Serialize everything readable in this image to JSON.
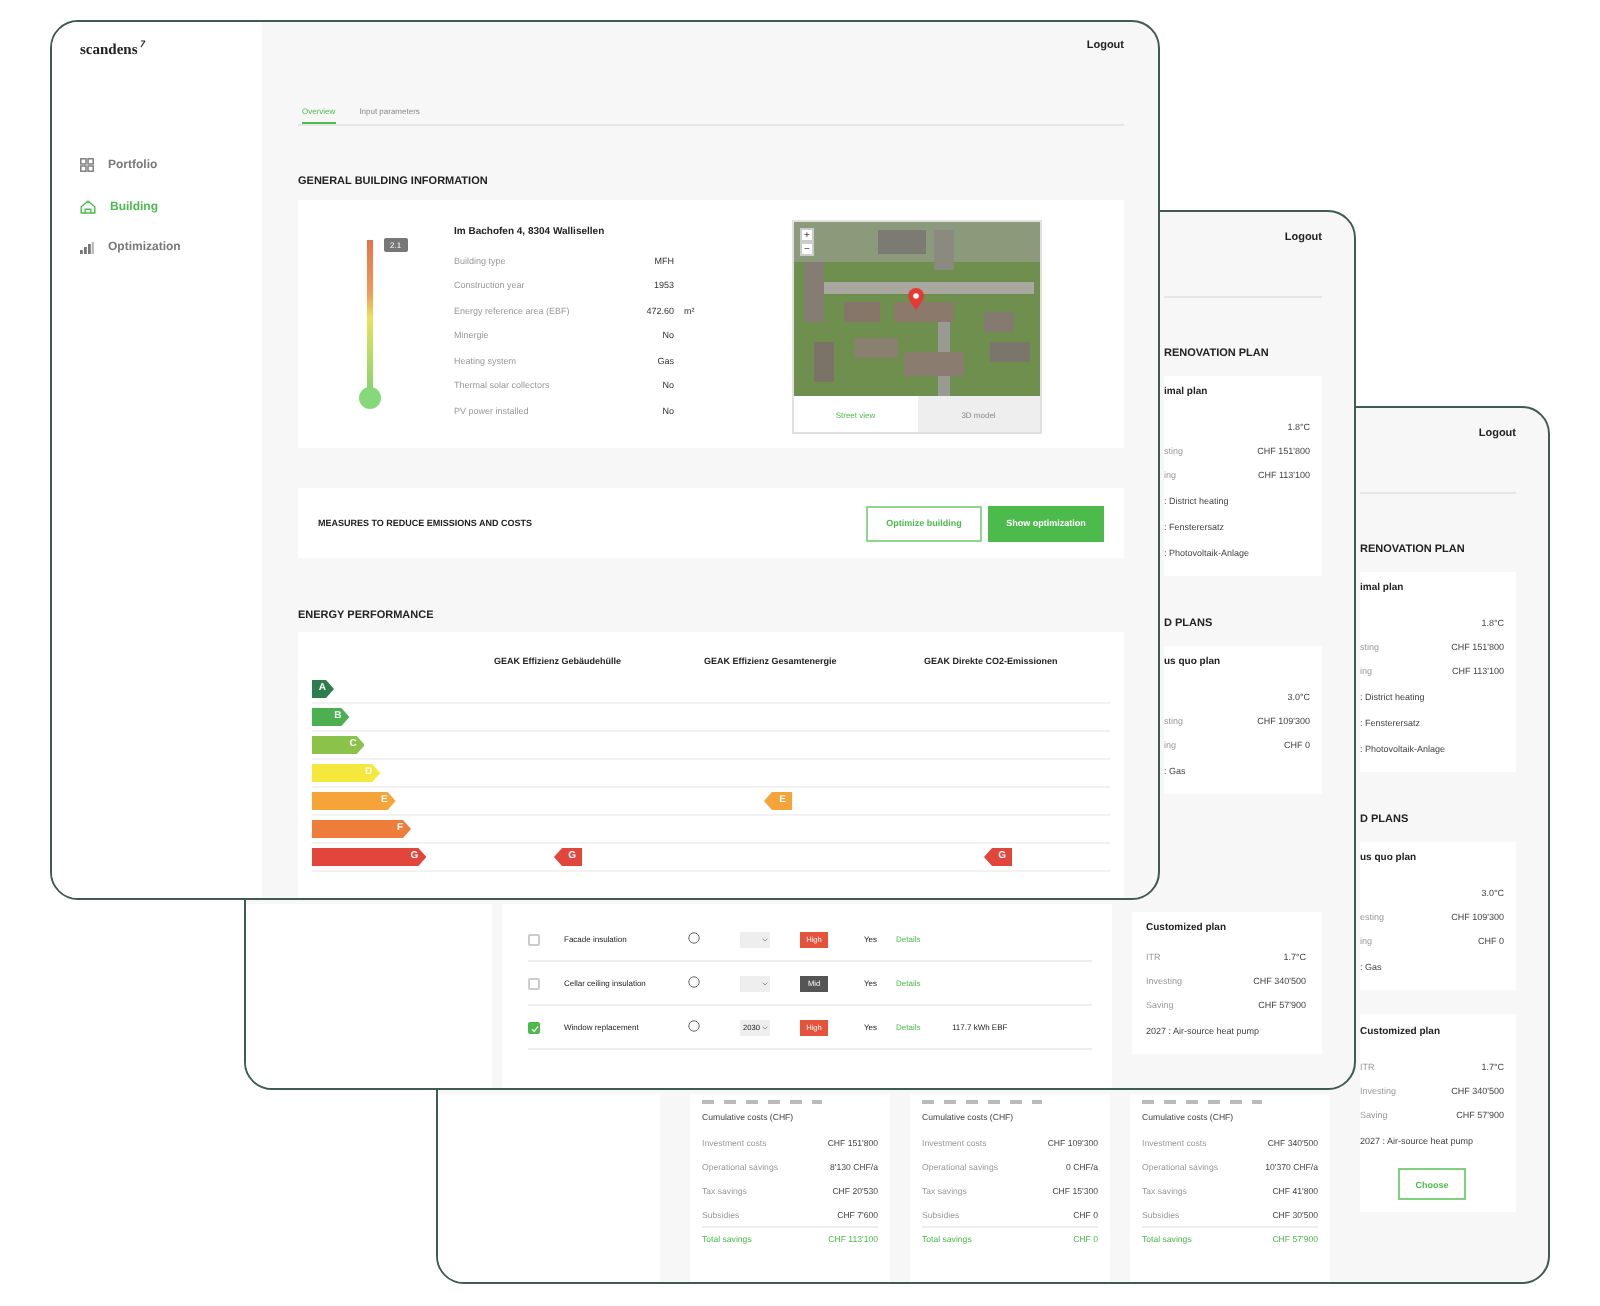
{
  "back_window": {
    "logout": "Logout",
    "section_title": "RENOVATION PLAN",
    "optimal_plan": {
      "title": "imal plan",
      "rows": [
        {
          "value": "1.8°C"
        },
        {
          "label": "sting",
          "value": "CHF 151'800"
        },
        {
          "label": "ing",
          "value": "CHF 113'100"
        }
      ],
      "measures": [
        ": District heating",
        ": Fensterersatz",
        ": Photovoltaik-Anlage"
      ]
    },
    "plans_title": "D PLANS",
    "status_quo_plan": {
      "title": "us quo plan",
      "rows": [
        {
          "value": "3.0°C"
        },
        {
          "label": "esting",
          "value": "CHF 109'300"
        },
        {
          "label": "ing",
          "value": "CHF 0"
        }
      ],
      "measures": [
        ": Gas"
      ]
    },
    "customized_plan": {
      "title": "Customized plan",
      "rows": [
        {
          "label": "ITR",
          "value": "1.7°C"
        },
        {
          "label": "Investing",
          "value": "CHF 340'500"
        },
        {
          "label": "Saving",
          "value": "CHF 57'900"
        }
      ],
      "measures": [
        "2027 : Air-source heat pump"
      ],
      "button": "Choose"
    },
    "plan_columns": [
      {
        "chart_label": "Cumulative costs (CHF)",
        "rows": [
          {
            "label": "Investment costs",
            "value": "CHF 151'800"
          },
          {
            "label": "Operational savings",
            "value": "8'130 CHF/a"
          },
          {
            "label": "Tax savings",
            "value": "CHF 20'530"
          },
          {
            "label": "Subsidies",
            "value": "CHF 7'600"
          }
        ],
        "total": {
          "label": "Total savings",
          "value": "CHF 113'100"
        }
      },
      {
        "chart_label": "Cumulative costs (CHF)",
        "rows": [
          {
            "label": "Investment costs",
            "value": "CHF 109'300"
          },
          {
            "label": "Operational savings",
            "value": "0 CHF/a"
          },
          {
            "label": "Tax savings",
            "value": "CHF 15'300"
          },
          {
            "label": "Subsidies",
            "value": "CHF 0"
          }
        ],
        "total": {
          "label": "Total savings",
          "value": "CHF 0"
        }
      },
      {
        "chart_label": "Cumulative costs (CHF)",
        "rows": [
          {
            "label": "Investment costs",
            "value": "CHF 340'500"
          },
          {
            "label": "Operational savings",
            "value": "10'370 CHF/a"
          },
          {
            "label": "Tax savings",
            "value": "CHF 41'800"
          },
          {
            "label": "Subsidies",
            "value": "CHF 30'500"
          }
        ],
        "total": {
          "label": "Total savings",
          "value": "CHF 57'900"
        }
      }
    ]
  },
  "middle_window": {
    "logout": "Logout",
    "section_title": "RENOVATION PLAN",
    "optimal_plan": {
      "title": "imal plan",
      "rows": [
        {
          "value": "1.8°C"
        },
        {
          "label": "sting",
          "value": "CHF 151'800"
        },
        {
          "label": "ing",
          "value": "CHF 113'100"
        }
      ],
      "measures": [
        ": District heating",
        ": Fensterersatz",
        ": Photovoltaik-Anlage"
      ]
    },
    "plans_title": "D PLANS",
    "status_quo_plan": {
      "title": "us quo plan",
      "rows": [
        {
          "value": "3.0°C"
        },
        {
          "label": "sting",
          "value": "CHF 109'300"
        },
        {
          "label": "ing",
          "value": "CHF 0"
        }
      ],
      "measures": [
        ": Gas"
      ]
    },
    "measures_table": [
      {
        "checked": false,
        "name": "Facade insulation",
        "priority": "High",
        "color": "#e5533d",
        "feasible": "Yes",
        "link": "Details"
      },
      {
        "checked": false,
        "name": "Cellar ceiling insulation",
        "priority": "Mid",
        "color": "#555555",
        "feasible": "Yes",
        "link": "Details"
      },
      {
        "checked": true,
        "name": "Window replacement",
        "year": "2030",
        "priority": "High",
        "color": "#e5533d",
        "feasible": "Yes",
        "link": "Details",
        "note": "117.7 kWh EBF"
      }
    ],
    "customized_plan": {
      "title": "Customized plan",
      "rows": [
        {
          "label": "ITR",
          "value": "1.7°C"
        },
        {
          "label": "Investing",
          "value": "CHF 340'500"
        },
        {
          "label": "Saving",
          "value": "CHF 57'900"
        }
      ],
      "measures": [
        "2027 : Air-source heat pump"
      ]
    }
  },
  "front_window": {
    "logo": "scandens",
    "logout": "Logout",
    "nav": [
      {
        "label": "Portfolio",
        "kind": "grid",
        "selected": false
      },
      {
        "label": "Building",
        "kind": "house",
        "selected": true
      },
      {
        "label": "Optimization",
        "kind": "chart",
        "selected": false
      }
    ],
    "tabs": [
      {
        "label": "Overview",
        "selected": true
      },
      {
        "label": "Input parameters",
        "selected": false
      }
    ],
    "general": {
      "title": "GENERAL BUILDING INFORMATION",
      "rating_badge": "2.1",
      "address": "Im Bachofen 4, 8304 Wallisellen",
      "properties": [
        {
          "label": "Building type",
          "value": "MFH"
        },
        {
          "label": "Construction year",
          "value": "1953"
        },
        {
          "label": "Energy reference area (EBF)",
          "value": "472.60",
          "unit": "m²"
        },
        {
          "label": "Minergie",
          "value": "No"
        },
        {
          "label": "Heating system",
          "value": "Gas"
        },
        {
          "label": "Thermal solar collectors",
          "value": "No"
        },
        {
          "label": "PV power installed",
          "value": "No"
        }
      ],
      "map": {
        "zoom_in": "+",
        "zoom_out": "−",
        "views": [
          {
            "label": "Street view",
            "selected": true
          },
          {
            "label": "3D model",
            "selected": false
          }
        ]
      }
    },
    "measures": {
      "title": "MEASURES TO REDUCE EMISSIONS AND COSTS",
      "buttons": [
        {
          "label": "Optimize building",
          "kind": "outline"
        },
        {
          "label": "Show optimization",
          "kind": "filled"
        }
      ]
    },
    "energy": {
      "title": "ENERGY PERFORMANCE",
      "columns": [
        "GEAK Effizienz Gebäudehülle",
        "GEAK Effizienz Gesamtenergie",
        "GEAK Direkte CO2-Emissionen"
      ],
      "classes": [
        {
          "label": "A",
          "color": "#2e7d4f",
          "cells": [
            {
              "marked": false
            },
            {
              "marked": false
            },
            {
              "marked": false
            }
          ]
        },
        {
          "label": "B",
          "color": "#4caf50",
          "cells": [
            {
              "marked": false
            },
            {
              "marked": false
            },
            {
              "marked": false
            }
          ]
        },
        {
          "label": "C",
          "color": "#8bc34a",
          "cells": [
            {
              "marked": false
            },
            {
              "marked": false
            },
            {
              "marked": false
            }
          ]
        },
        {
          "label": "D",
          "color": "#f5e83c",
          "cells": [
            {
              "marked": false
            },
            {
              "marked": false
            },
            {
              "marked": false
            }
          ]
        },
        {
          "label": "E",
          "color": "#f6a33a",
          "cells": [
            {
              "marked": false
            },
            {
              "marked": true,
              "label": "E"
            },
            {
              "marked": false
            }
          ]
        },
        {
          "label": "F",
          "color": "#ee7c3a",
          "cells": [
            {
              "marked": false
            },
            {
              "marked": false
            },
            {
              "marked": false
            }
          ]
        },
        {
          "label": "G",
          "color": "#e2453c",
          "cells": [
            {
              "marked": true,
              "label": "G"
            },
            {
              "marked": false
            },
            {
              "marked": true,
              "label": "G"
            }
          ]
        }
      ]
    }
  }
}
